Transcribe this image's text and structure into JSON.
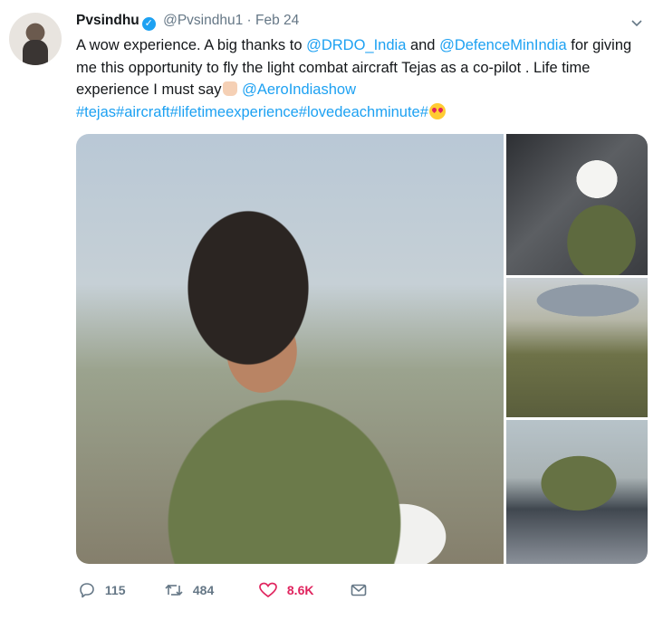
{
  "tweet": {
    "name": "Pvsindhu",
    "handle": "@Pvsindhu1",
    "separator": "·",
    "date": "Feb 24",
    "text": {
      "p1": "A wow experience. A big thanks to ",
      "mention1": "@DRDO_India",
      "p2": " and ",
      "mention2": "@DefenceMinIndia",
      "p3": " for giving me this opportunity  to fly the light combat aircraft Tejas as a co-pilot . Life time experience I must say",
      "mention3": "@AeroIndiashow",
      "hashtags": "#tejas#aircraft#lifetimeexperience#lovedeachminute#"
    }
  },
  "actions": {
    "replies": "115",
    "retweets": "484",
    "likes": "8.6K"
  },
  "icons": {
    "verified": "verified-badge-icon",
    "chevron": "chevron-down-icon",
    "reply": "reply-icon",
    "retweet": "retweet-icon",
    "like": "heart-icon",
    "dm": "envelope-icon"
  },
  "colors": {
    "link": "#1da1f2",
    "like": "#e0245e",
    "muted": "#657786"
  }
}
